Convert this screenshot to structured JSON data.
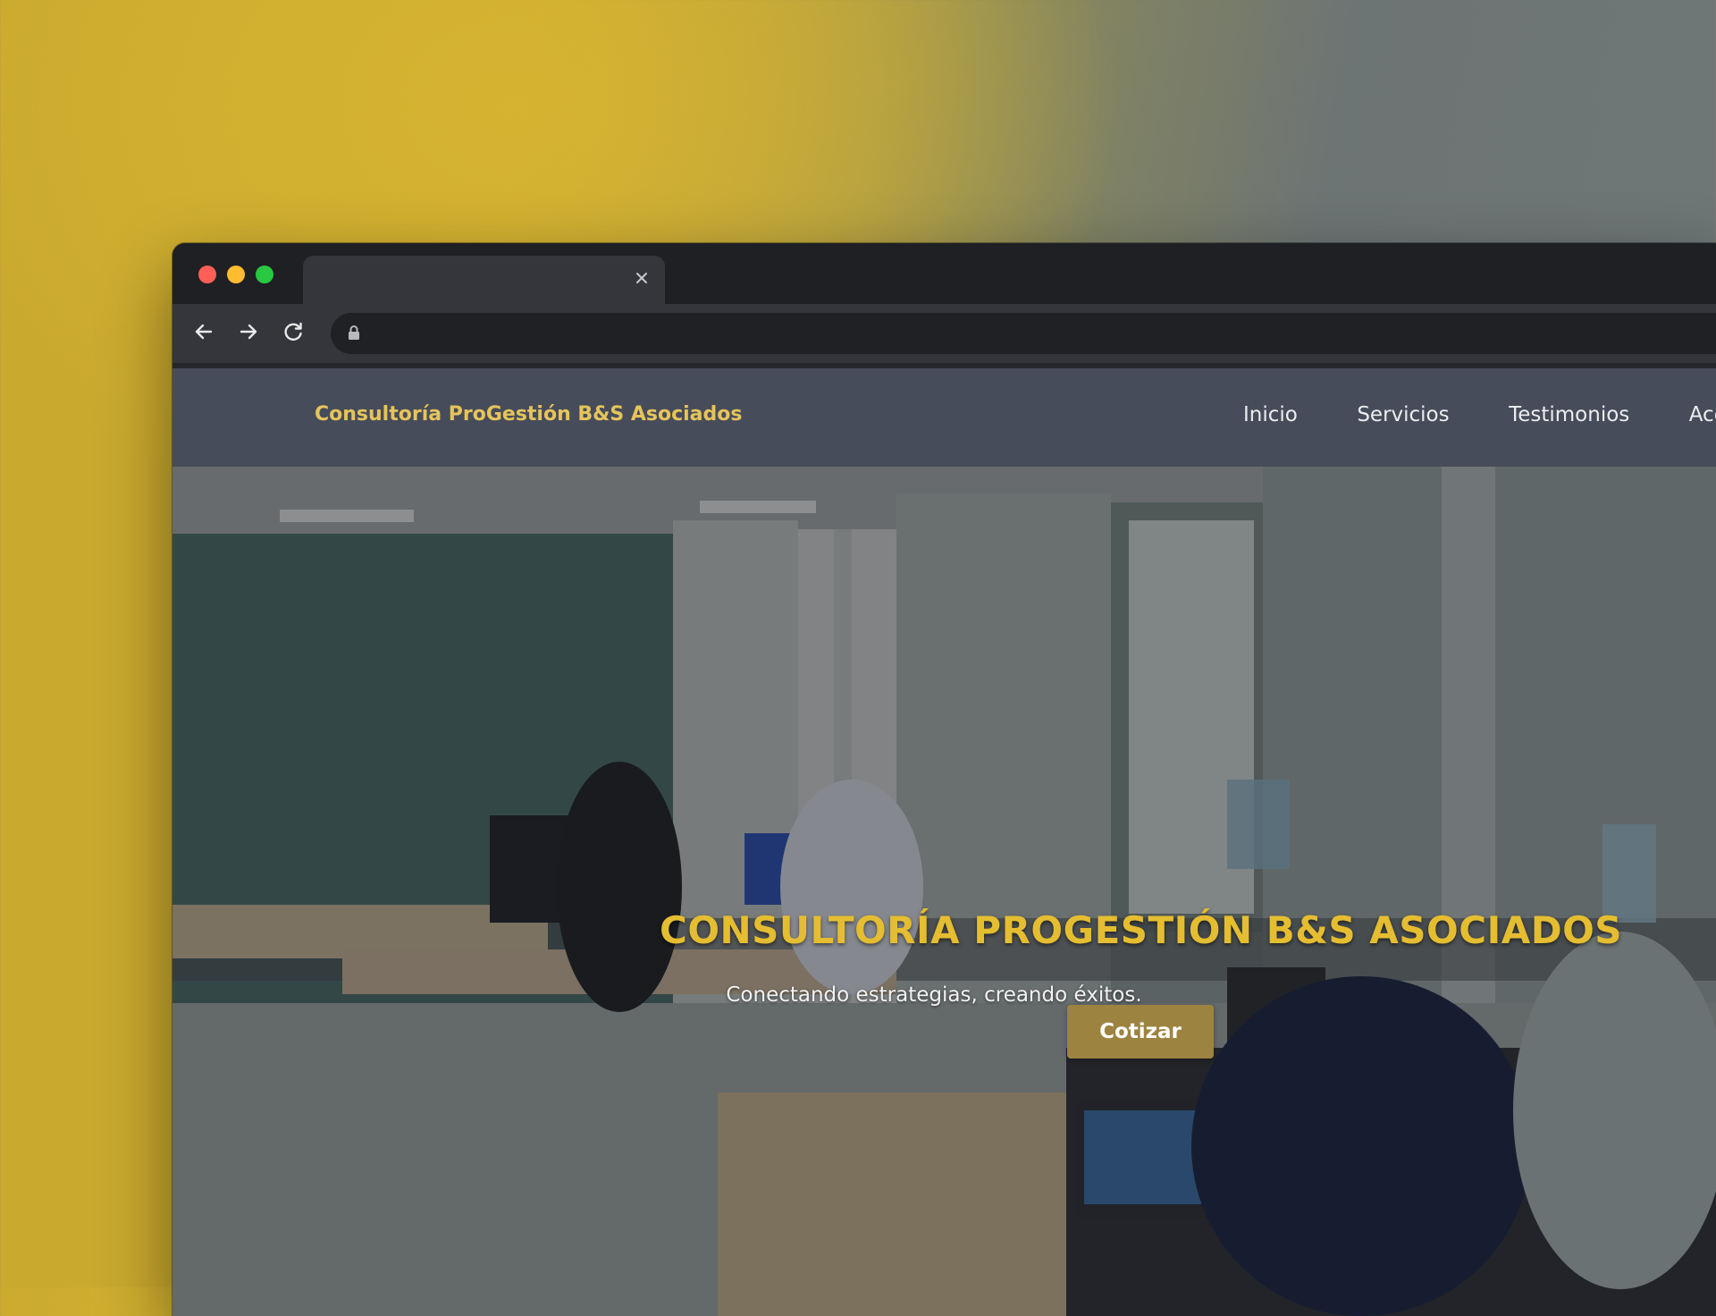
{
  "browser": {
    "tab_title": "",
    "url": "",
    "icons": {
      "close": "close-icon",
      "back": "arrow-left-icon",
      "forward": "arrow-right-icon",
      "reload": "reload-icon",
      "lock": "lock-icon"
    }
  },
  "site": {
    "brand": "Consultoría ProGestión B&S Asociados",
    "nav": [
      "Inicio",
      "Servicios",
      "Testimonios",
      "Acerca"
    ],
    "hero": {
      "title": "CONSULTORÍA PROGESTIÓN B&S ASOCIADOS",
      "subtitle": "Conectando estrategias, creando éxitos.",
      "cta_label": "Cotizar"
    }
  },
  "colors": {
    "brand_gold": "#e5c45a",
    "hero_title_gold": "#e5bd31",
    "cta_bg": "#9c8340",
    "header_bg": "#474c5a"
  }
}
